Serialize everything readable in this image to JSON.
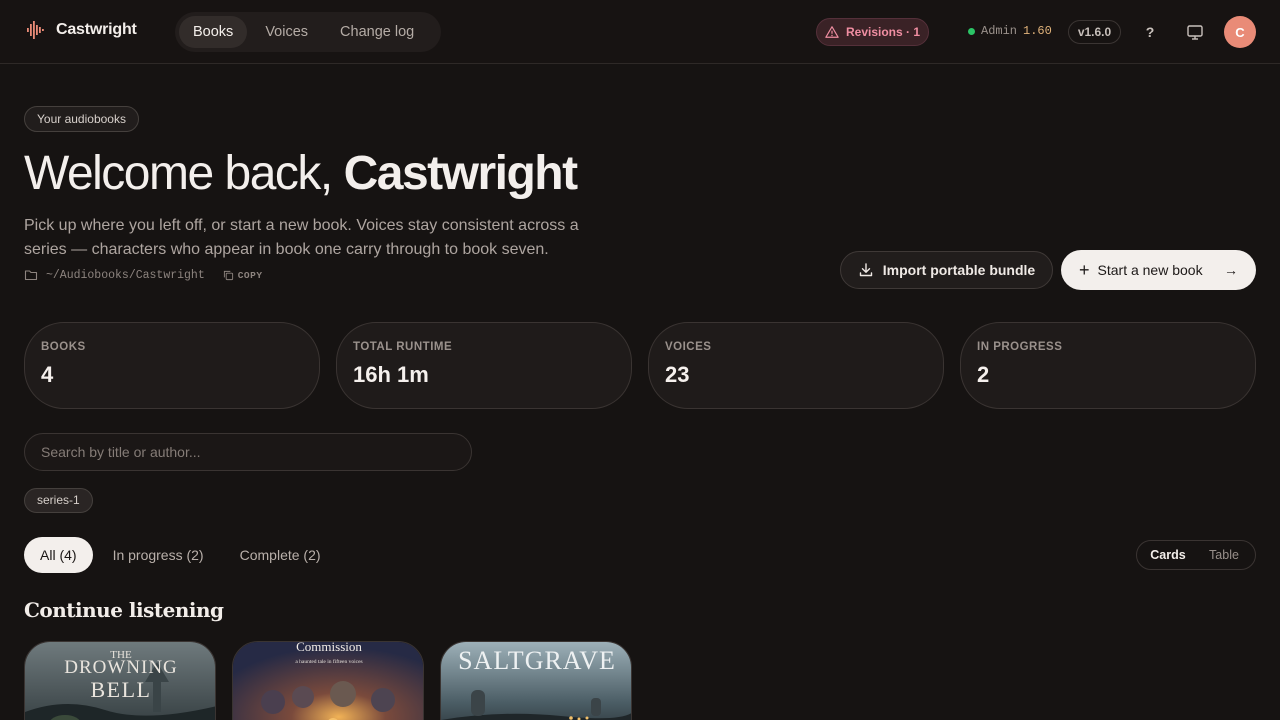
{
  "app": {
    "name": "Castwright",
    "nav": [
      {
        "label": "Books",
        "active": true
      },
      {
        "label": "Voices",
        "active": false
      },
      {
        "label": "Change log",
        "active": false
      }
    ],
    "revisions_label": "Revisions · 1",
    "admin_label": "Admin",
    "admin_value": "1.60",
    "status_color": "#2bc466",
    "version": "v1.6.0",
    "help_label": "?",
    "avatar_initial": "C"
  },
  "hero": {
    "chip": "Your audiobooks",
    "greeting": "Welcome back, ",
    "user": "Castwright",
    "subtitle": "Pick up where you left off, or start a new book. Voices stay consistent across a series — characters who appear in book one carry through to book seven.",
    "path": "~/Audiobooks/Castwright",
    "copy_label": "COPY",
    "import_label": "Import portable bundle",
    "start_label": "Start a new book"
  },
  "stats": [
    {
      "label": "BOOKS",
      "value": "4"
    },
    {
      "label": "TOTAL RUNTIME",
      "value": "16h 1m"
    },
    {
      "label": "VOICES",
      "value": "23"
    },
    {
      "label": "IN PROGRESS",
      "value": "2"
    }
  ],
  "search": {
    "placeholder": "Search by title or author..."
  },
  "tags": [
    "series-1"
  ],
  "filters": [
    {
      "label": "All (4)",
      "active": true
    },
    {
      "label": "In progress (2)",
      "active": false
    },
    {
      "label": "Complete (2)",
      "active": false
    }
  ],
  "view_toggle": {
    "cards": "Cards",
    "table": "Table",
    "active": "Cards"
  },
  "section_title": "Continue listening",
  "covers": [
    {
      "title_line1": "THE",
      "title_line2": "DROWNING",
      "title_line3": "BELL"
    },
    {
      "title": "Commission",
      "subtitle": "a haunted tale in fifteen voices"
    },
    {
      "title": "SALTGRAVE"
    }
  ],
  "colors": {
    "accent": "#e98b77",
    "revision": "#f08ea2",
    "background": "#161312"
  }
}
